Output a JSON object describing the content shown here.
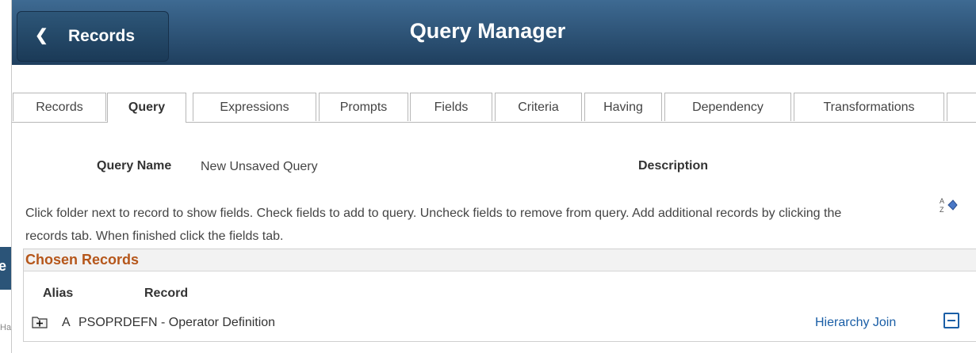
{
  "header": {
    "back_label": "Records",
    "title": "Query Manager"
  },
  "tabs": [
    {
      "label": "Records"
    },
    {
      "label": "Query"
    },
    {
      "label": "Expressions"
    },
    {
      "label": "Prompts"
    },
    {
      "label": "Fields"
    },
    {
      "label": "Criteria"
    },
    {
      "label": "Having"
    },
    {
      "label": "Dependency"
    },
    {
      "label": "Transformations"
    }
  ],
  "active_tab": "Query",
  "query": {
    "name_label": "Query Name",
    "name_value": "New Unsaved Query",
    "description_label": "Description"
  },
  "instructions": "Click folder next to record to show fields. Check fields to add to query. Uncheck fields to remove from query. Add additional records by clicking the records tab. When finished click the fields tab.",
  "chosen_records": {
    "title": "Chosen Records",
    "columns": {
      "alias": "Alias",
      "record": "Record"
    },
    "rows": [
      {
        "alias": "A",
        "record": "PSOPRDEFN - Operator Definition",
        "link": "Hierarchy Join"
      }
    ]
  },
  "background_window": {
    "strip_text": "e",
    "footer_text": "Ha"
  },
  "colors": {
    "header_top": "#3e6a92",
    "header_bottom": "#1f3f5e",
    "section_title": "#b5561a",
    "link": "#1a5ea6"
  },
  "icons": [
    "chevron-left-icon",
    "sort-icon",
    "folder-plus-icon",
    "minus-icon"
  ]
}
